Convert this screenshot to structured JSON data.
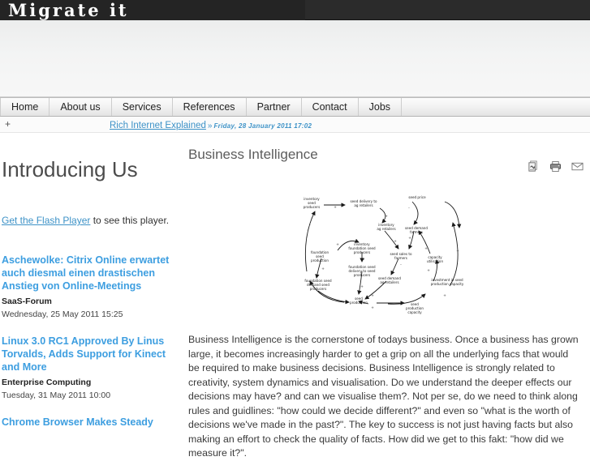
{
  "site": {
    "logo_text": "Migrate it"
  },
  "nav": {
    "items": [
      {
        "label": "Home"
      },
      {
        "label": "About us"
      },
      {
        "label": "Services"
      },
      {
        "label": "References"
      },
      {
        "label": "Partner"
      },
      {
        "label": "Contact"
      },
      {
        "label": "Jobs"
      }
    ]
  },
  "ticker": {
    "plus": "+",
    "headline": "Rich Internet Explained",
    "arrow": "»",
    "date": "Friday, 28 January 2011 17:02"
  },
  "sidebar": {
    "title": "Introducing Us",
    "flash_link": "Get the Flash Player",
    "flash_rest": " to see this player.",
    "news": [
      {
        "title": "Aschewolke: Citrix Online erwartet auch diesmal einen drastischen Anstieg von Online-Meetings",
        "source": "SaaS-Forum",
        "date": "Wednesday, 25 May 2011 15:25"
      },
      {
        "title": "Linux 3.0 RC1 Approved By Linus Torvalds, Adds Support for Kinect and More",
        "source": "Enterprise Computing",
        "date": "Tuesday, 31 May 2011 10:00"
      },
      {
        "title": "Chrome Browser Makes Steady",
        "source": "",
        "date": ""
      }
    ]
  },
  "article": {
    "title": "Business Intelligence",
    "tools": [
      {
        "name": "pdf-icon",
        "label": "PDF"
      },
      {
        "name": "print-icon",
        "label": "Print"
      },
      {
        "name": "email-icon",
        "label": "E-mail"
      }
    ],
    "body": "Business Intelligence is the cornerstone of todays business. Once a business has grown large, it becomes increasingly harder to get a grip on all the underlying facs that would be required to make business decisions. Business Intelligence is strongly related to creativity, system dynamics and visualisation. Do we understand the deeper effects our decisions may have? and can we visualise them?. Not per se, do we need to think along rules and guidlines: \"how could we decide different?\" and even so \"what is the worth of decisions we've made in the past?\".  The key to success is not just having facts but also making an effort to check the quality of facts. How did we get to this fakt: \"how did we measure it?\"."
  },
  "diagram": {
    "alt": "causal loop diagram of seed supply chain",
    "nodes": [
      "inventory seed producers",
      "seed delivery to ag retailers",
      "inventory ag retailers",
      "seed price",
      "seed demand farmers",
      "seed sales to farmers",
      "seed demand ag retailers",
      "capacity utilisation",
      "investment in seed production capacity",
      "seed production capacity",
      "seed production",
      "foundation seed production",
      "foundation seed delivery to seed producers",
      "inventory foundation seed producers",
      "foundation seed demand seed producers"
    ]
  },
  "colors": {
    "header_dark": "#2b2b2b",
    "logo_block": "#242424",
    "link_blue": "#3d92c7",
    "news_blue": "#3d9ee0",
    "title_grey": "#5c5c5c"
  }
}
